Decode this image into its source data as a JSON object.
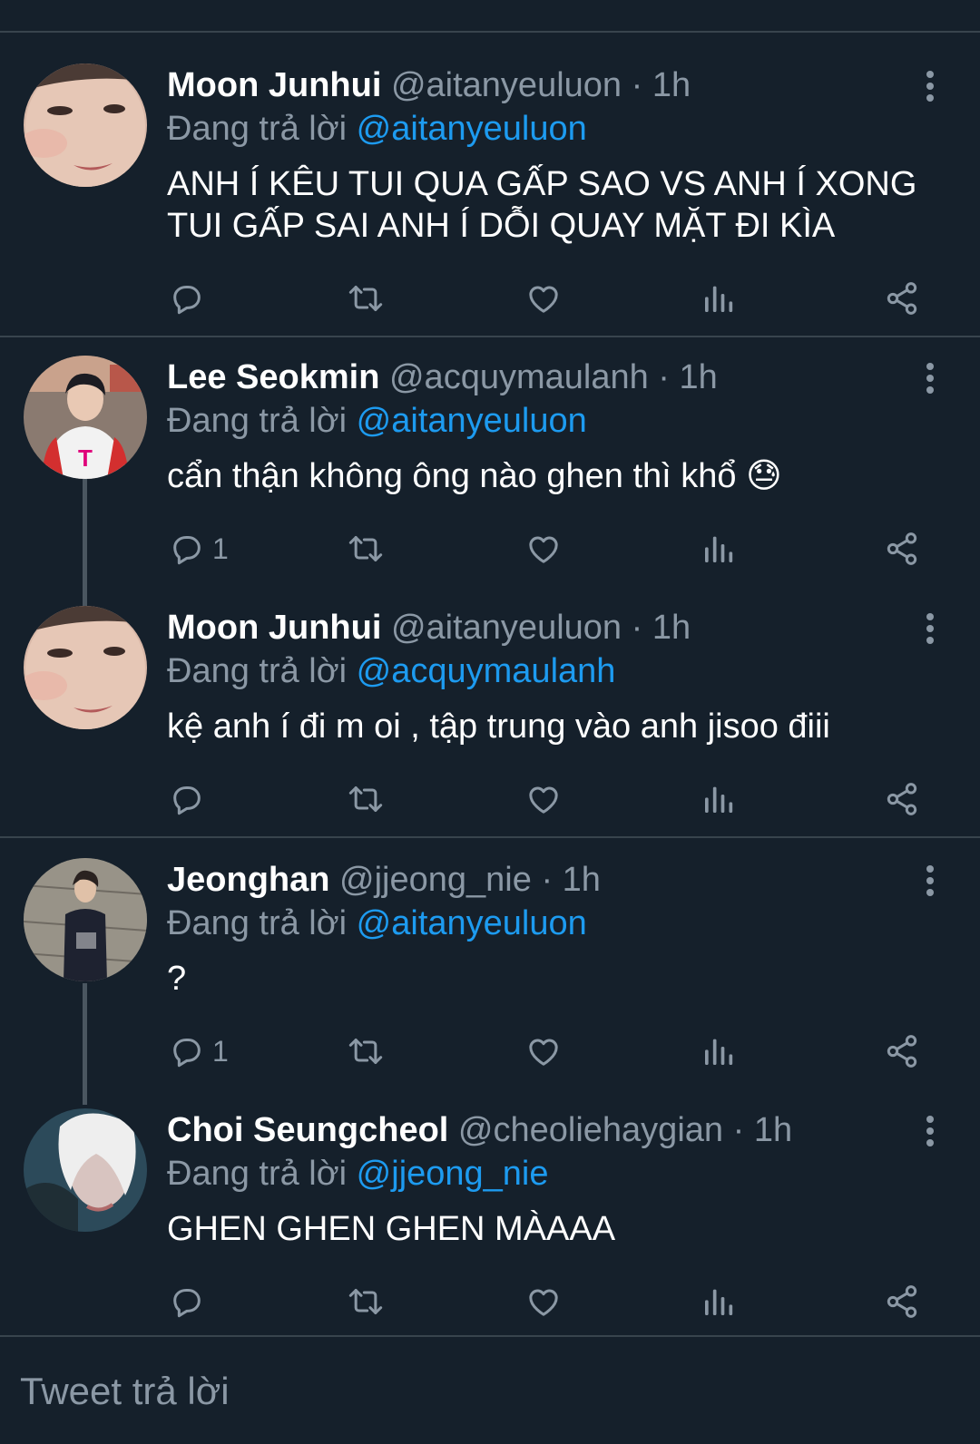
{
  "reply_prefix": "Đang trả lời",
  "tweets": [
    {
      "name": "Moon Junhui",
      "handle": "@aitanyeuluon",
      "time": "1h",
      "reply_to": "@aitanyeuluon",
      "text": "ANH Í KÊU TUI QUA GẤP SAO VS ANH Í XONG TUI GẤP SAI ANH Í DỖI QUAY MẶT ĐI KÌA",
      "reply_count": ""
    },
    {
      "name": "Lee Seokmin",
      "handle": "@acquymaulanh",
      "time": "1h",
      "reply_to": "@aitanyeuluon",
      "text": "cẩn thận không ông nào ghen thì khổ 😓",
      "reply_count": "1"
    },
    {
      "name": "Moon Junhui",
      "handle": "@aitanyeuluon",
      "time": "1h",
      "reply_to": "@acquymaulanh",
      "text": "kệ anh í đi m oi , tập trung vào anh jisoo điii",
      "reply_count": ""
    },
    {
      "name": "Jeonghan",
      "handle": "@jjeong_nie",
      "time": "1h",
      "reply_to": "@aitanyeuluon",
      "text": "?",
      "reply_count": "1"
    },
    {
      "name": "Choi Seungcheol",
      "handle": "@cheoliehaygian",
      "time": "1h",
      "reply_to": "@jjeong_nie",
      "text": "GHEN GHEN GHEN MÀAAA",
      "reply_count": ""
    }
  ],
  "composer": {
    "placeholder": "Tweet trả lời"
  },
  "colors": {
    "background": "#15202b",
    "divider": "#38444d",
    "muted": "#8b98a5",
    "link": "#1d9bf0"
  },
  "icons": [
    "reply-icon",
    "retweet-icon",
    "like-icon",
    "views-icon",
    "share-icon",
    "more-icon"
  ]
}
